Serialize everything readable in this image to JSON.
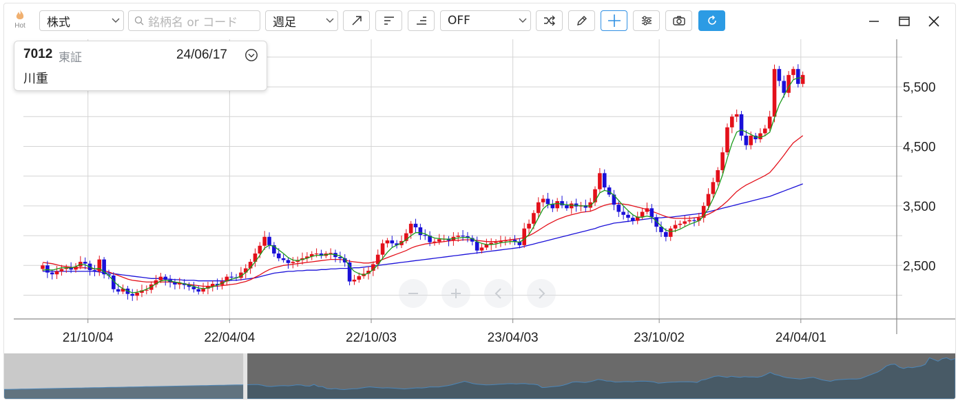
{
  "app": {
    "hot_label": "Hot"
  },
  "toolbar": {
    "market_select": "株式",
    "search_placeholder": "銘柄名 or コード",
    "period_select": "週足",
    "indicator_select": "OFF",
    "tools": [
      "trendline-icon",
      "align-left-icon",
      "align-right-icon",
      "shuffle-icon",
      "pencil-icon",
      "crosshair-icon",
      "settings-sliders-icon",
      "camera-icon",
      "refresh-icon"
    ]
  },
  "stock": {
    "code": "7012",
    "market": "東証",
    "date": "24/06/17",
    "name": "川重"
  },
  "colors": {
    "up": "#e3101a",
    "down": "#1a10d8",
    "ma_short": "#1a9a1a",
    "ma_mid": "#e3101a",
    "ma_long": "#1a10d8",
    "accent": "#2c9be4",
    "grid": "#d4d4d4"
  },
  "chart_data": {
    "type": "candlestick",
    "x_tick_labels": [
      "21/10/04",
      "22/04/04",
      "22/10/03",
      "23/04/03",
      "23/10/02",
      "24/04/01"
    ],
    "y_tick_labels": [
      "2,500",
      "3,500",
      "4,500",
      "5,500"
    ],
    "y_ticks": [
      2500,
      3500,
      4500,
      5500
    ],
    "ylim": [
      1600,
      6300
    ],
    "start_week": 0,
    "last_date": "24/06/17",
    "weeks_visible": 146,
    "close": [
      2500,
      2380,
      2350,
      2400,
      2440,
      2470,
      2430,
      2480,
      2560,
      2530,
      2420,
      2400,
      2600,
      2350,
      2330,
      2100,
      2060,
      2110,
      2020,
      1990,
      2040,
      2080,
      2090,
      2180,
      2250,
      2310,
      2260,
      2220,
      2180,
      2200,
      2170,
      2140,
      2100,
      2060,
      2110,
      2150,
      2190,
      2170,
      2230,
      2310,
      2300,
      2290,
      2380,
      2450,
      2560,
      2700,
      2830,
      2980,
      2840,
      2700,
      2620,
      2590,
      2540,
      2560,
      2590,
      2620,
      2650,
      2690,
      2700,
      2660,
      2700,
      2710,
      2640,
      2620,
      2550,
      2230,
      2260,
      2320,
      2360,
      2410,
      2520,
      2680,
      2870,
      2920,
      2870,
      2840,
      2910,
      3040,
      3200,
      3140,
      3010,
      3000,
      2890,
      2900,
      2940,
      2950,
      2920,
      2980,
      3000,
      2990,
      2960,
      2900,
      2750,
      2800,
      2850,
      2880,
      2890,
      2910,
      2920,
      2930,
      2900,
      2840,
      3120,
      3200,
      3380,
      3560,
      3620,
      3530,
      3460,
      3580,
      3510,
      3460,
      3540,
      3490,
      3510,
      3470,
      3560,
      3780,
      4050,
      3810,
      3690,
      3520,
      3400,
      3350,
      3300,
      3250,
      3320,
      3400,
      3460,
      3310,
      3150,
      3060,
      2980,
      3120,
      3180,
      3200,
      3240,
      3260,
      3250,
      3300,
      3500,
      3700,
      3900,
      4100,
      4400,
      4820,
      5000,
      5040,
      4680,
      4520,
      4680,
      4620,
      4720,
      4800,
      5000,
      5800,
      5600,
      5400,
      5700,
      5800,
      5550,
      5700
    ],
    "ma_short": [
      2420,
      2430,
      2420,
      2440,
      2460,
      2460,
      2460,
      2480,
      2520,
      2510,
      2470,
      2440,
      2450,
      2390,
      2330,
      2240,
      2160,
      2110,
      2070,
      2040,
      2050,
      2070,
      2100,
      2140,
      2190,
      2240,
      2250,
      2240,
      2220,
      2210,
      2190,
      2170,
      2150,
      2120,
      2110,
      2120,
      2140,
      2170,
      2200,
      2240,
      2270,
      2290,
      2320,
      2380,
      2460,
      2560,
      2670,
      2790,
      2840,
      2820,
      2760,
      2700,
      2630,
      2590,
      2580,
      2600,
      2620,
      2650,
      2670,
      2670,
      2680,
      2690,
      2680,
      2660,
      2610,
      2480,
      2400,
      2360,
      2340,
      2370,
      2430,
      2510,
      2620,
      2720,
      2800,
      2840,
      2880,
      2930,
      3000,
      3050,
      3050,
      3030,
      2990,
      2960,
      2950,
      2940,
      2940,
      2950,
      2960,
      2970,
      2970,
      2950,
      2900,
      2870,
      2850,
      2850,
      2860,
      2880,
      2890,
      2900,
      2900,
      2890,
      2940,
      3020,
      3150,
      3300,
      3450,
      3520,
      3530,
      3540,
      3530,
      3520,
      3510,
      3510,
      3500,
      3500,
      3500,
      3580,
      3720,
      3760,
      3740,
      3680,
      3590,
      3500,
      3420,
      3350,
      3310,
      3310,
      3330,
      3310,
      3240,
      3160,
      3090,
      3070,
      3080,
      3110,
      3150,
      3190,
      3220,
      3250,
      3330,
      3460,
      3620,
      3800,
      4020,
      4300,
      4550,
      4740,
      4780,
      4740,
      4700,
      4660,
      4650,
      4680,
      4740,
      4980,
      5200,
      5350,
      5500,
      5620,
      5650,
      5650
    ],
    "ma_mid": [
      2550,
      2540,
      2530,
      2510,
      2490,
      2480,
      2470,
      2460,
      2460,
      2460,
      2450,
      2440,
      2430,
      2410,
      2390,
      2360,
      2330,
      2300,
      2270,
      2250,
      2240,
      2230,
      2220,
      2220,
      2220,
      2220,
      2220,
      2220,
      2210,
      2200,
      2190,
      2180,
      2170,
      2160,
      2150,
      2150,
      2150,
      2150,
      2160,
      2170,
      2180,
      2190,
      2210,
      2230,
      2260,
      2300,
      2340,
      2390,
      2430,
      2460,
      2480,
      2500,
      2510,
      2520,
      2530,
      2540,
      2550,
      2560,
      2570,
      2580,
      2590,
      2600,
      2600,
      2600,
      2590,
      2570,
      2560,
      2550,
      2540,
      2540,
      2550,
      2570,
      2600,
      2630,
      2660,
      2690,
      2720,
      2750,
      2790,
      2820,
      2840,
      2860,
      2870,
      2880,
      2890,
      2900,
      2910,
      2920,
      2920,
      2930,
      2930,
      2930,
      2920,
      2910,
      2900,
      2900,
      2900,
      2910,
      2920,
      2930,
      2940,
      2950,
      2970,
      3000,
      3040,
      3090,
      3140,
      3190,
      3230,
      3270,
      3300,
      3330,
      3350,
      3370,
      3390,
      3400,
      3410,
      3440,
      3480,
      3510,
      3530,
      3540,
      3540,
      3530,
      3520,
      3500,
      3480,
      3460,
      3440,
      3410,
      3380,
      3350,
      3320,
      3300,
      3290,
      3290,
      3290,
      3290,
      3300,
      3310,
      3330,
      3360,
      3400,
      3450,
      3510,
      3580,
      3660,
      3740,
      3800,
      3850,
      3890,
      3930,
      3970,
      4010,
      4060,
      4150,
      4250,
      4350,
      4460,
      4560,
      4620,
      4680
    ],
    "ma_long": [
      2400,
      2400,
      2400,
      2400,
      2400,
      2400,
      2400,
      2400,
      2400,
      2400,
      2400,
      2400,
      2390,
      2380,
      2370,
      2360,
      2350,
      2340,
      2330,
      2320,
      2310,
      2300,
      2290,
      2280,
      2280,
      2280,
      2270,
      2270,
      2260,
      2260,
      2250,
      2250,
      2250,
      2240,
      2240,
      2240,
      2240,
      2240,
      2240,
      2240,
      2250,
      2250,
      2260,
      2270,
      2280,
      2290,
      2310,
      2330,
      2350,
      2370,
      2380,
      2390,
      2400,
      2400,
      2410,
      2410,
      2420,
      2420,
      2420,
      2430,
      2430,
      2440,
      2440,
      2450,
      2450,
      2450,
      2460,
      2460,
      2470,
      2480,
      2490,
      2500,
      2510,
      2520,
      2530,
      2540,
      2550,
      2560,
      2570,
      2580,
      2590,
      2600,
      2610,
      2620,
      2630,
      2640,
      2650,
      2660,
      2670,
      2680,
      2690,
      2700,
      2710,
      2720,
      2730,
      2740,
      2750,
      2760,
      2770,
      2780,
      2790,
      2800,
      2820,
      2840,
      2860,
      2880,
      2900,
      2920,
      2940,
      2960,
      2980,
      3000,
      3020,
      3040,
      3060,
      3080,
      3100,
      3120,
      3150,
      3170,
      3190,
      3210,
      3220,
      3230,
      3240,
      3250,
      3260,
      3270,
      3280,
      3290,
      3300,
      3300,
      3310,
      3310,
      3320,
      3330,
      3340,
      3350,
      3360,
      3370,
      3380,
      3400,
      3420,
      3440,
      3460,
      3480,
      3500,
      3520,
      3540,
      3560,
      3580,
      3600,
      3620,
      3640,
      3660,
      3690,
      3720,
      3750,
      3780,
      3810,
      3840,
      3870
    ]
  },
  "navigator": {
    "controls": [
      "minus-icon",
      "plus-icon",
      "chevron-left-icon",
      "chevron-right-icon"
    ],
    "range_start": 0.255,
    "range_end": 1.0
  }
}
